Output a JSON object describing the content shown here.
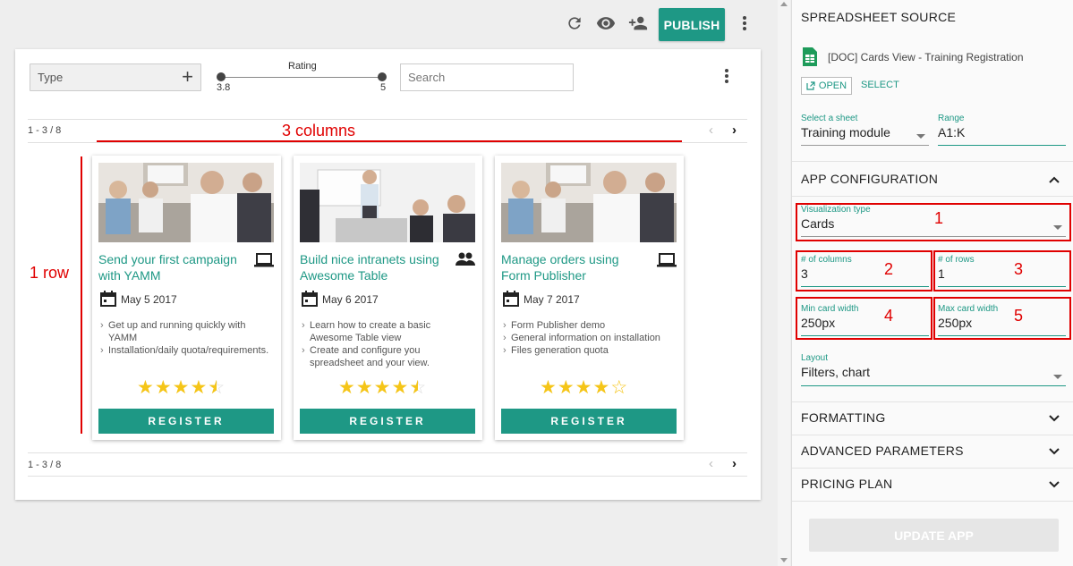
{
  "toolbar": {
    "publish_label": "PUBLISH",
    "icons": [
      "refresh-icon",
      "eye-icon",
      "add-user-icon",
      "more-vert-icon"
    ]
  },
  "filters": {
    "type_label": "Type",
    "rating_label": "Rating",
    "rating_min": "3.8",
    "rating_max": "5",
    "search_placeholder": "Search"
  },
  "pager": {
    "range_text": "1 - 3 / 8"
  },
  "annotations": {
    "columns": "3 columns",
    "rows": "1 row"
  },
  "cards": [
    {
      "title": "Send your first campaign with YAMM",
      "date": "May 5 2017",
      "type_icon": "laptop-icon",
      "bullets": [
        "Get up and running quickly with YAMM",
        "Installation/daily quota/requirements."
      ],
      "rating_stars": "★★★★⯪",
      "register_label": "REGISTER"
    },
    {
      "title": "Build nice intranets using Awesome Table",
      "date": "May 6 2017",
      "type_icon": "people-icon",
      "bullets": [
        "Learn how to create a basic Awesome Table view",
        "Create and configure you spreadsheet and your view."
      ],
      "rating_stars": "★★★★⯪",
      "register_label": "REGISTER"
    },
    {
      "title": "Manage orders using Form Publisher",
      "date": "May 7 2017",
      "type_icon": "laptop-icon",
      "bullets": [
        "Form Publisher demo",
        "General information on installation",
        "Files generation quota"
      ],
      "rating_stars": "★★★★☆",
      "register_label": "REGISTER"
    }
  ],
  "sidebar": {
    "source_title": "SPREADSHEET SOURCE",
    "doc_name": "[DOC] Cards View - Training Registration",
    "open_label": "OPEN",
    "select_label": "SELECT",
    "sheet_label": "Select a sheet",
    "sheet_value": "Training module",
    "range_label": "Range",
    "range_value": "A1:K",
    "app_config_title": "APP CONFIGURATION",
    "vis_type_label": "Visualization type",
    "vis_type_value": "Cards",
    "columns_label": "# of columns",
    "columns_value": "3",
    "rows_label": "# of rows",
    "rows_value": "1",
    "min_width_label": "Min card width",
    "min_width_value": "250px",
    "max_width_label": "Max card width",
    "max_width_value": "250px",
    "layout_label": "Layout",
    "layout_value": "Filters, chart",
    "formatting_title": "FORMATTING",
    "advanced_title": "ADVANCED PARAMETERS",
    "pricing_title": "PRICING PLAN",
    "update_label": "UPDATE APP",
    "annotation_numbers": [
      "1",
      "2",
      "3",
      "4",
      "5"
    ]
  },
  "colors": {
    "accent": "#1e9885",
    "annotation": "#e00000",
    "star": "#f5c518"
  }
}
